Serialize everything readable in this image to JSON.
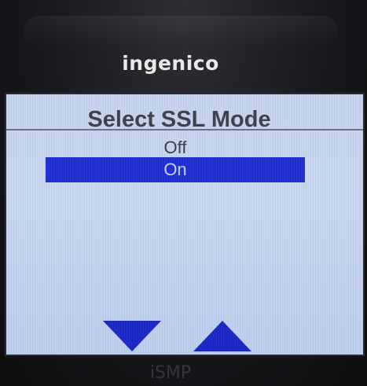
{
  "device": {
    "brand": "ingenico",
    "model": "iSMP"
  },
  "screen": {
    "title": "Select SSL Mode",
    "options": [
      {
        "label": "Off",
        "selected": false
      },
      {
        "label": "On",
        "selected": true
      }
    ],
    "controls": {
      "scroll_down_icon": "triangle-down",
      "scroll_up_icon": "triangle-up"
    },
    "colors": {
      "screen_background": "#c6d4ee",
      "highlight": "#1e2ed0",
      "arrow": "#1a27c4",
      "text": "#3a3d45"
    }
  }
}
